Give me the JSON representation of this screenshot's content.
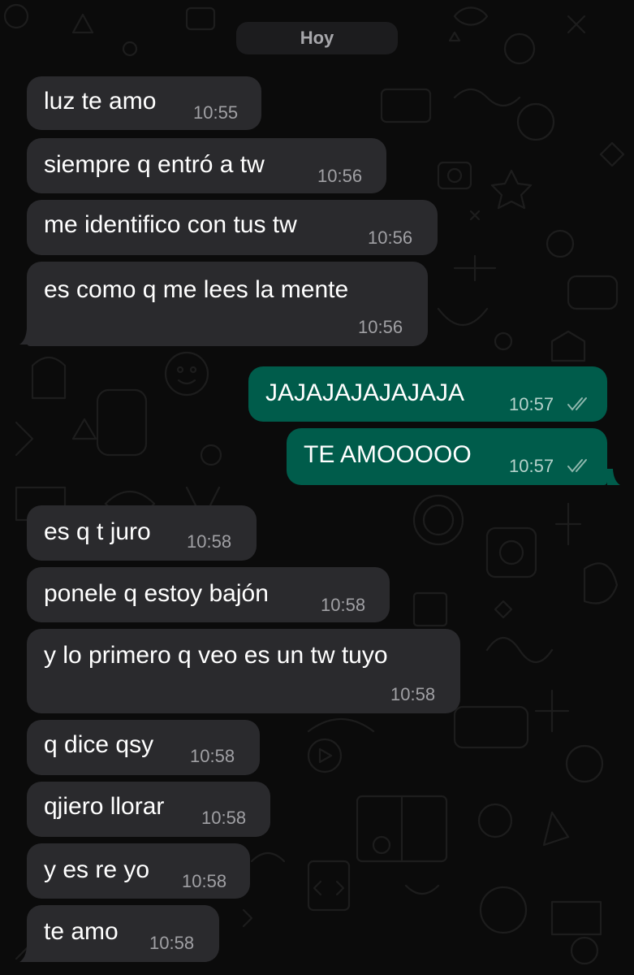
{
  "chat": {
    "date_separator": "Hoy",
    "messages": [
      {
        "direction": "incoming",
        "text": "luz te amo",
        "time": "10:55"
      },
      {
        "direction": "incoming",
        "text": "siempre q entró a tw",
        "time": "10:56"
      },
      {
        "direction": "incoming",
        "text": "me identifico con tus tw",
        "time": "10:56"
      },
      {
        "direction": "incoming",
        "text": "es como q me lees la mente",
        "time": "10:56"
      },
      {
        "direction": "outgoing",
        "text": "JAJAJAJAJAJAJA",
        "time": "10:57",
        "status": "read-ticks-icon"
      },
      {
        "direction": "outgoing",
        "text": "TE AMOOOOO",
        "time": "10:57",
        "status": "read-ticks-icon"
      },
      {
        "direction": "incoming",
        "text": "es q t juro",
        "time": "10:58"
      },
      {
        "direction": "incoming",
        "text": "ponele q estoy bajón",
        "time": "10:58"
      },
      {
        "direction": "incoming",
        "text": "y lo primero q veo es un tw tuyo",
        "time": "10:58"
      },
      {
        "direction": "incoming",
        "text": "q dice qsy",
        "time": "10:58"
      },
      {
        "direction": "incoming",
        "text": "qjiero llorar",
        "time": "10:58"
      },
      {
        "direction": "incoming",
        "text": "y es re yo",
        "time": "10:58"
      },
      {
        "direction": "incoming",
        "text": "te amo",
        "time": "10:58"
      }
    ]
  },
  "colors": {
    "background": "#0b0b0b",
    "incoming_bubble": "#2a2a2d",
    "outgoing_bubble": "#005c4b",
    "date_chip": "#1c1c1e"
  }
}
